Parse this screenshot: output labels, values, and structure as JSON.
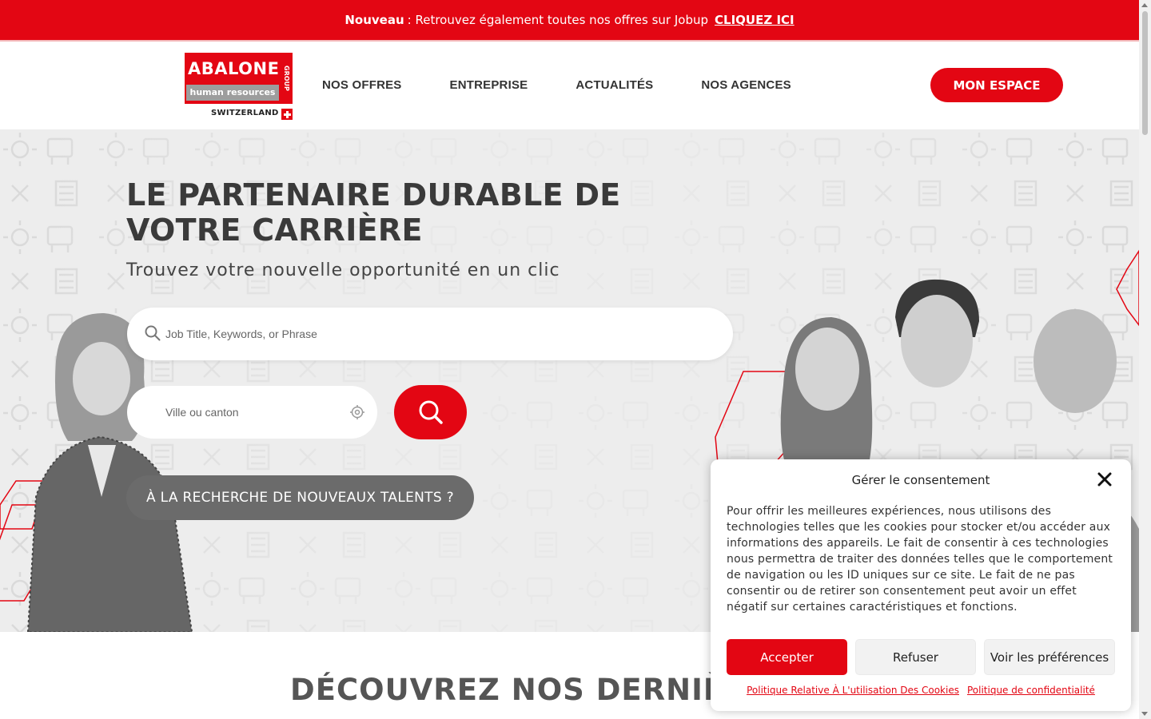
{
  "announcement": {
    "label": "Nouveau",
    "text": ": Retrouvez également toutes nos offres sur Jobup",
    "link": "CLIQUEZ ICI"
  },
  "logo": {
    "name": "ABALONE",
    "tagline": "human resources",
    "group": "GROUP",
    "country": "SWITZERLAND"
  },
  "nav": {
    "items": [
      "NOS OFFRES",
      "ENTREPRISE",
      "ACTUALITÉS",
      "NOS AGENCES"
    ],
    "account_button": "MON ESPACE"
  },
  "hero": {
    "title": "LE PARTENAIRE DURABLE DE VOTRE CARRIÈRE",
    "subtitle": "Trouvez votre nouvelle opportunité en un clic",
    "search_placeholder": "Job Title, Keywords, or Phrase",
    "location_placeholder": "Ville ou canton",
    "talents_button": "À LA RECHERCHE DE NOUVEAUX TALENTS ?"
  },
  "section": {
    "title": "DÉCOUVREZ NOS DERNIÈRE"
  },
  "consent": {
    "title": "Gérer le consentement",
    "text": "Pour offrir les meilleures expériences, nous utilisons des technologies telles que les cookies pour stocker et/ou accéder aux informations des appareils. Le fait de consentir à ces technologies nous permettra de traiter des données telles que le comportement de navigation ou les ID uniques sur ce site. Le fait de ne pas consentir ou de retirer son consentement peut avoir un effet négatif sur certaines caractéristiques et fonctions.",
    "accept": "Accepter",
    "refuse": "Refuser",
    "preferences": "Voir les préférences",
    "link_cookies": "Politique Relative À L'utilisation Des Cookies",
    "link_privacy": "Politique de confidentialité"
  },
  "colors": {
    "brand_red": "#e30613",
    "button_gray": "#6b6b6b",
    "hero_bg": "#ededed"
  },
  "icons": [
    "search-icon",
    "location-target-icon",
    "close-icon",
    "swiss-flag-icon"
  ]
}
